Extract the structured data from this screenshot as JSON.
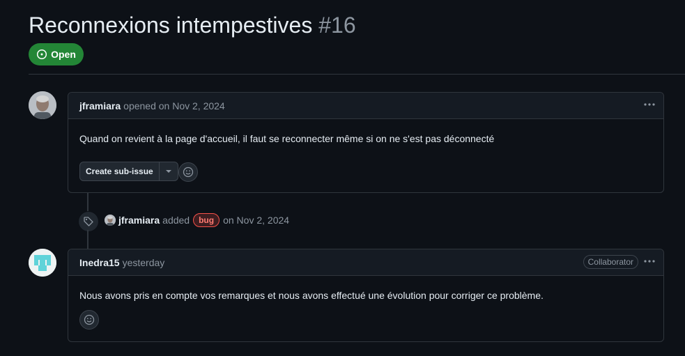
{
  "issue": {
    "title": "Reconnexions intempestives",
    "number": "#16",
    "state": "Open",
    "state_color": "#238636"
  },
  "comments": [
    {
      "author": "jframiara",
      "meta": "opened on Nov 2, 2024",
      "body": "Quand on revient à la page d'accueil, il faut se reconnecter même si on ne s'est pas déconnecté",
      "actions": {
        "create_sub_issue": "Create sub-issue"
      }
    },
    {
      "author": "Inedra15",
      "meta": "yesterday",
      "role_badge": "Collaborator",
      "body": "Nous avons pris en compte vos remarques et nous avons effectué une évolution pour corriger ce problème."
    }
  ],
  "event": {
    "actor": "jframiara",
    "action": "added",
    "label": "bug",
    "label_color": "#f85149",
    "date": "on Nov 2, 2024"
  },
  "icons": [
    "issue-open-icon",
    "kebab-icon",
    "smiley-icon",
    "tag-icon",
    "caret-down-icon"
  ]
}
